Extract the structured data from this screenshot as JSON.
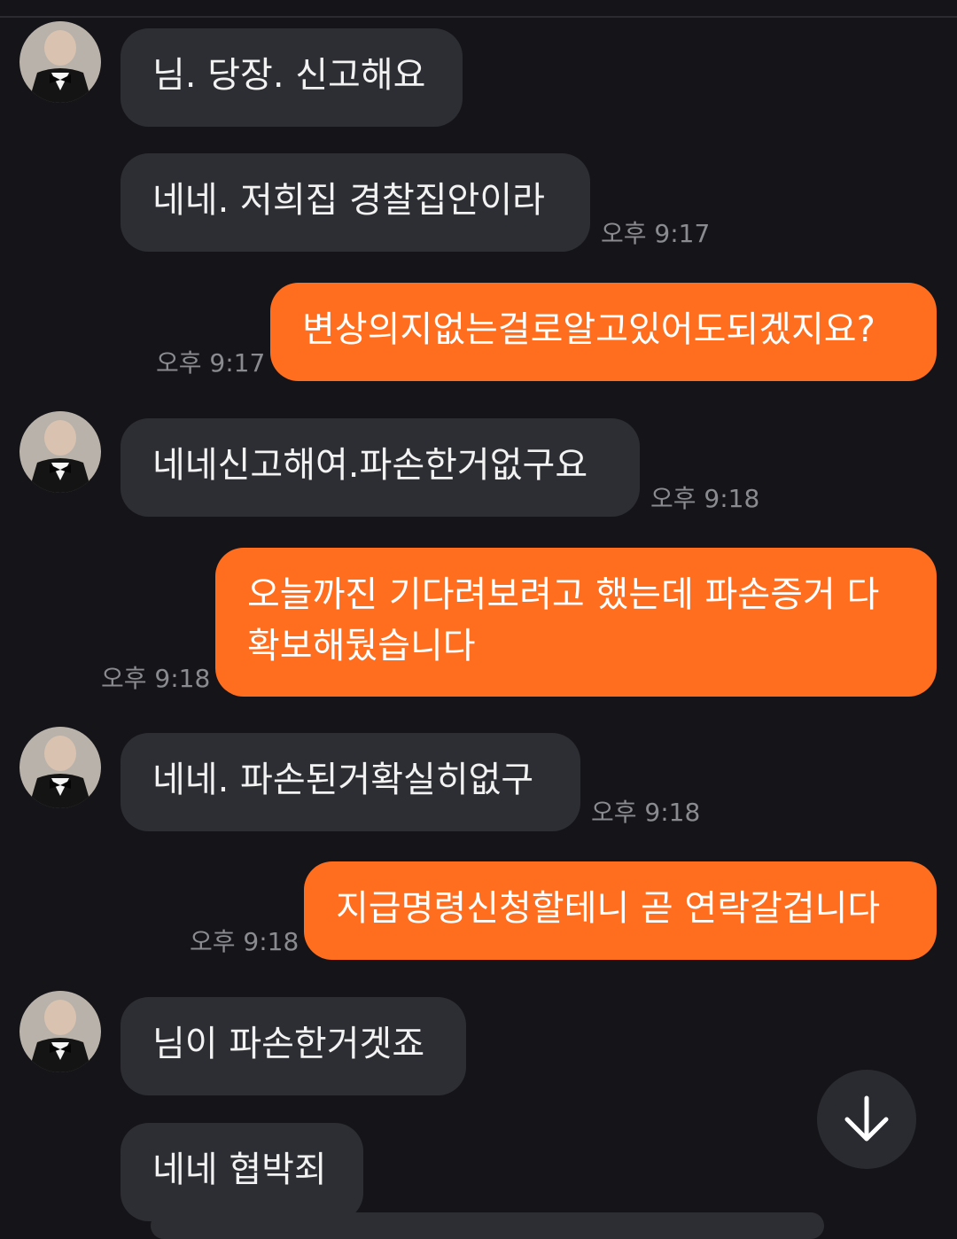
{
  "colors": {
    "background": "#151519",
    "incoming_bubble": "#2d2e33",
    "outgoing_bubble": "#ff6d1f",
    "timestamp": "#8a8b90"
  },
  "messages": [
    {
      "direction": "in",
      "text": "님. 당장. 신고해요",
      "time": ""
    },
    {
      "direction": "in",
      "text": "네네. 저희집 경찰집안이라",
      "time": "오후 9:17"
    },
    {
      "direction": "out",
      "text": "변상의지없는걸로알고있어도되겠지요?",
      "time": "오후 9:17"
    },
    {
      "direction": "in",
      "text": "네네신고해여.파손한거없구요",
      "time": "오후 9:18"
    },
    {
      "direction": "out",
      "text": "오늘까진 기다려보려고 했는데 파손증거 다\n확보해뒀습니다",
      "time": "오후 9:18"
    },
    {
      "direction": "in",
      "text": "네네. 파손된거확실히없구",
      "time": "오후 9:18"
    },
    {
      "direction": "out",
      "text": "지급명령신청할테니 곧 연락갈겁니다",
      "time": "오후 9:18"
    },
    {
      "direction": "in",
      "text": "님이 파손한거겟죠",
      "time": ""
    },
    {
      "direction": "in",
      "text": "네네 협박죄",
      "time": ""
    }
  ],
  "controls": {
    "scroll_down_icon": "arrow-down-icon"
  }
}
